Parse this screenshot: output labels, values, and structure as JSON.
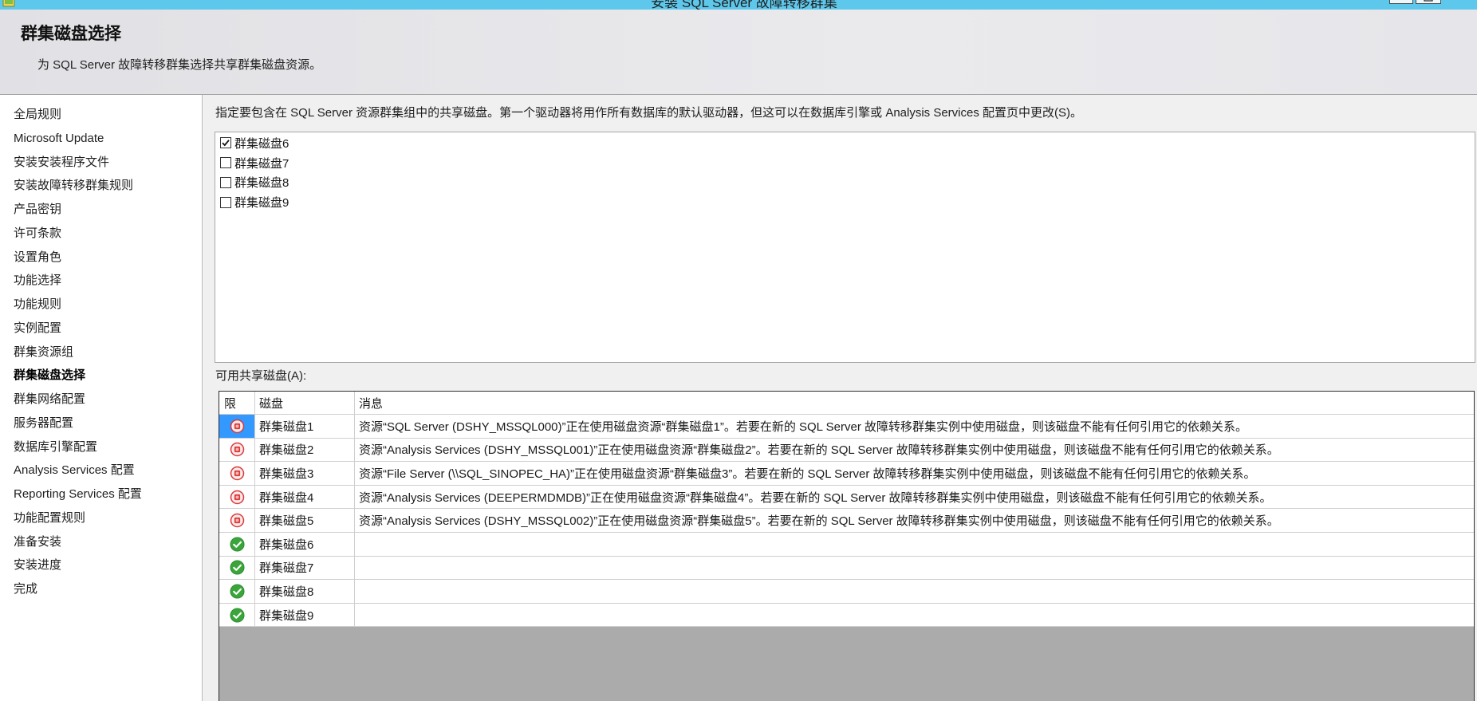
{
  "window": {
    "title": "安装 SQL Server 故障转移群集",
    "icon": "setup-app-icon"
  },
  "header": {
    "title": "群集磁盘选择",
    "subtitle": "为 SQL Server 故障转移群集选择共享群集磁盘资源。"
  },
  "sidebar": {
    "items": [
      "全局规则",
      "Microsoft Update",
      "安装安装程序文件",
      "安装故障转移群集规则",
      "产品密钥",
      "许可条款",
      "设置角色",
      "功能选择",
      "功能规则",
      "实例配置",
      "群集资源组",
      "群集磁盘选择",
      "群集网络配置",
      "服务器配置",
      "数据库引擎配置",
      "Analysis Services 配置",
      "Reporting Services 配置",
      "功能配置规则",
      "准备安装",
      "安装进度",
      "完成"
    ],
    "current_index": 11
  },
  "main": {
    "instruction": "指定要包含在 SQL Server 资源群集组中的共享磁盘。第一个驱动器将用作所有数据库的默认驱动器，但这可以在数据库引擎或 Analysis Services 配置页中更改(S)。",
    "disks": [
      {
        "label": "群集磁盘6",
        "checked": true
      },
      {
        "label": "群集磁盘7",
        "checked": false
      },
      {
        "label": "群集磁盘8",
        "checked": false
      },
      {
        "label": "群集磁盘9",
        "checked": false
      }
    ],
    "available_label": "可用共享磁盘(A):",
    "table": {
      "columns": {
        "status": "限",
        "disk": "磁盘",
        "message": "消息"
      },
      "selected_row": 0,
      "rows": [
        {
          "icon": "stop-icon",
          "disk": "群集磁盘1",
          "message": "资源“SQL Server (DSHY_MSSQL000)”正在使用磁盘资源“群集磁盘1”。若要在新的 SQL Server 故障转移群集实例中使用磁盘，则该磁盘不能有任何引用它的依赖关系。"
        },
        {
          "icon": "stop-icon",
          "disk": "群集磁盘2",
          "message": "资源“Analysis Services (DSHY_MSSQL001)”正在使用磁盘资源“群集磁盘2”。若要在新的 SQL Server 故障转移群集实例中使用磁盘，则该磁盘不能有任何引用它的依赖关系。"
        },
        {
          "icon": "stop-icon",
          "disk": "群集磁盘3",
          "message": "资源“File Server (\\\\SQL_SINOPEC_HA)”正在使用磁盘资源“群集磁盘3”。若要在新的 SQL Server 故障转移群集实例中使用磁盘，则该磁盘不能有任何引用它的依赖关系。"
        },
        {
          "icon": "stop-icon",
          "disk": "群集磁盘4",
          "message": "资源“Analysis Services (DEEPERMDMDB)”正在使用磁盘资源“群集磁盘4”。若要在新的 SQL Server 故障转移群集实例中使用磁盘，则该磁盘不能有任何引用它的依赖关系。"
        },
        {
          "icon": "stop-icon",
          "disk": "群集磁盘5",
          "message": "资源“Analysis Services (DSHY_MSSQL002)”正在使用磁盘资源“群集磁盘5”。若要在新的 SQL Server 故障转移群集实例中使用磁盘，则该磁盘不能有任何引用它的依赖关系。"
        },
        {
          "icon": "check-icon",
          "disk": "群集磁盘6",
          "message": ""
        },
        {
          "icon": "check-icon",
          "disk": "群集磁盘7",
          "message": ""
        },
        {
          "icon": "check-icon",
          "disk": "群集磁盘8",
          "message": ""
        },
        {
          "icon": "check-icon",
          "disk": "群集磁盘9",
          "message": ""
        }
      ]
    }
  },
  "colors": {
    "title_bar": "#5ec8ec",
    "selection": "#3399ff",
    "error": "#d83a3a",
    "ok": "#3aa53a",
    "grid_empty_area": "#ababab"
  }
}
